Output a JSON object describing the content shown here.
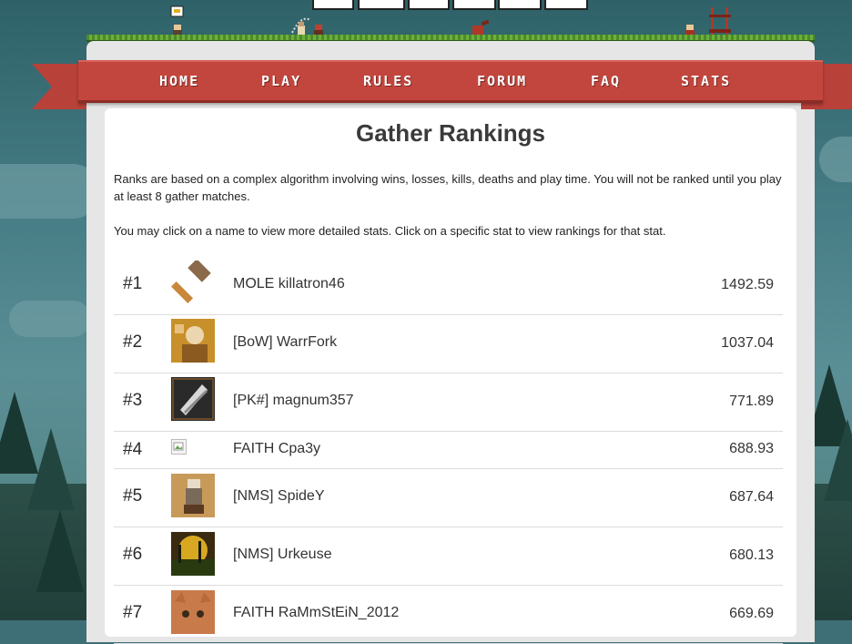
{
  "nav": {
    "items": [
      {
        "label": "HOME"
      },
      {
        "label": "PLAY"
      },
      {
        "label": "RULES"
      },
      {
        "label": "FORUM"
      },
      {
        "label": "FAQ"
      },
      {
        "label": "STATS"
      }
    ]
  },
  "page": {
    "title": "Gather Rankings",
    "intro_1": "Ranks are based on a complex algorithm involving wins, losses, kills, deaths and play time. You will not be ranked until you play at least 8 gather matches.",
    "intro_2": "You may click on a name to view more detailed stats. Click on a specific stat to view rankings for that stat."
  },
  "rankings": [
    {
      "rank": "#1",
      "name": "MOLE killatron46",
      "score": "1492.59",
      "avatar": "hammer-avatar"
    },
    {
      "rank": "#2",
      "name": "[BoW] WarrFork",
      "score": "1037.04",
      "avatar": "knight-avatar"
    },
    {
      "rank": "#3",
      "name": "[PK#] magnum357",
      "score": "771.89",
      "avatar": "blade-avatar"
    },
    {
      "rank": "#4",
      "name": "FAITH Cpa3y",
      "score": "688.93",
      "avatar": "broken-image-icon"
    },
    {
      "rank": "#5",
      "name": "[NMS] SpideY",
      "score": "687.64",
      "avatar": "builder-avatar"
    },
    {
      "rank": "#6",
      "name": "[NMS] Urkeuse",
      "score": "680.13",
      "avatar": "sunset-avatar"
    },
    {
      "rank": "#7",
      "name": "FAITH RaMmStEiN_2012",
      "score": "669.69",
      "avatar": "cat-avatar"
    }
  ],
  "colors": {
    "ribbon": "#c2463d",
    "panel": "#e6e6e6",
    "background": "#3f6f76"
  }
}
